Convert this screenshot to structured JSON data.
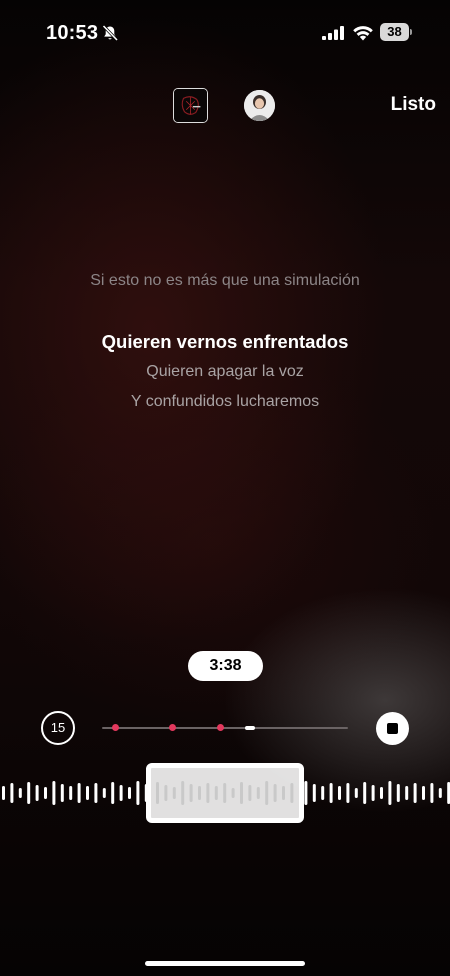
{
  "status_bar": {
    "time": "10:53",
    "battery": "38",
    "icons": [
      "bell-slash-icon",
      "cellular-signal-icon",
      "wifi-icon",
      "battery-icon"
    ]
  },
  "top_bar": {
    "done_label": "Listo",
    "cover_icon": "album-cover-thumbnail",
    "avatar_icon": "profile-avatar"
  },
  "lyrics": {
    "previous": "Si esto no es más que una simulación",
    "current": "Quieren vernos enfrentados",
    "next": [
      "Quieren apagar la voz",
      "Y confundidos lucharemos"
    ]
  },
  "player": {
    "duration": "3:38",
    "skip_back_label": "15",
    "markers_count": 3,
    "accent_color": "#e3385d"
  },
  "colors": {
    "background": "#0a0505",
    "lyric_current": "#ffffff",
    "lyric_dim": "#a9a3a4"
  }
}
